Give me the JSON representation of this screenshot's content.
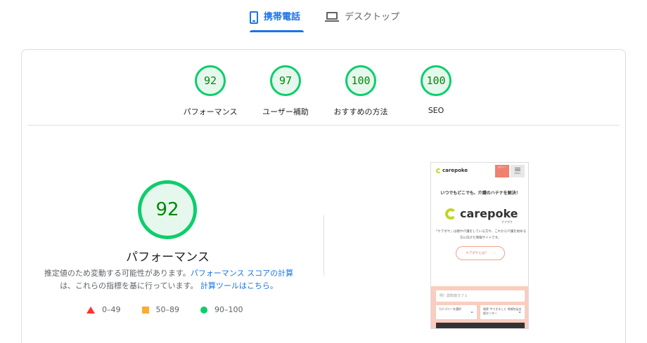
{
  "tabs": [
    {
      "label": "携帯電話",
      "icon": "phone-icon",
      "active": true
    },
    {
      "label": "デスクトップ",
      "icon": "laptop-icon",
      "active": false
    }
  ],
  "categories": [
    {
      "score": "92",
      "label": "パフォーマンス"
    },
    {
      "score": "97",
      "label": "ユーザー補助"
    },
    {
      "score": "100",
      "label": "おすすめの方法"
    },
    {
      "score": "100",
      "label": "SEO"
    }
  ],
  "main": {
    "score": "92",
    "title": "パフォーマンス",
    "desc_1": "推定値のため変動する可能性があります。",
    "desc_link_1": "パフォーマンス スコアの計算",
    "desc_2": "は、これらの指標を基に行っています。",
    "desc_link_2": "計算ツールはこちら。"
  },
  "legend": [
    {
      "range": "0–49",
      "color": "#ff3333",
      "shape": "triangle"
    },
    {
      "range": "50–89",
      "color": "#ffaa33",
      "shape": "square"
    },
    {
      "range": "90–100",
      "color": "#0cce6b",
      "shape": "circle"
    }
  ],
  "screenshot": {
    "logo_small": "carepoke",
    "login": "ログイン",
    "menu": "MENU",
    "headline": "いつでもどこでも、介護のハテナを解決！",
    "logo_big": "carepoke",
    "logo_sub": "ケアポケ",
    "desc": "「ケアポケ」は親や介護をしている方や、これから介護を始める方に向けた情報サイトです。",
    "button": "ケアポケとは？",
    "search_placeholder": "例）認知症カフェ",
    "select_1": "カテゴリーを選択",
    "select_2": "検索 今できること 地域包括支援センター"
  },
  "colors": {
    "accent": "#1a73e8",
    "pass": "#0cce6b",
    "average": "#ffaa33",
    "fail": "#ff3333"
  }
}
